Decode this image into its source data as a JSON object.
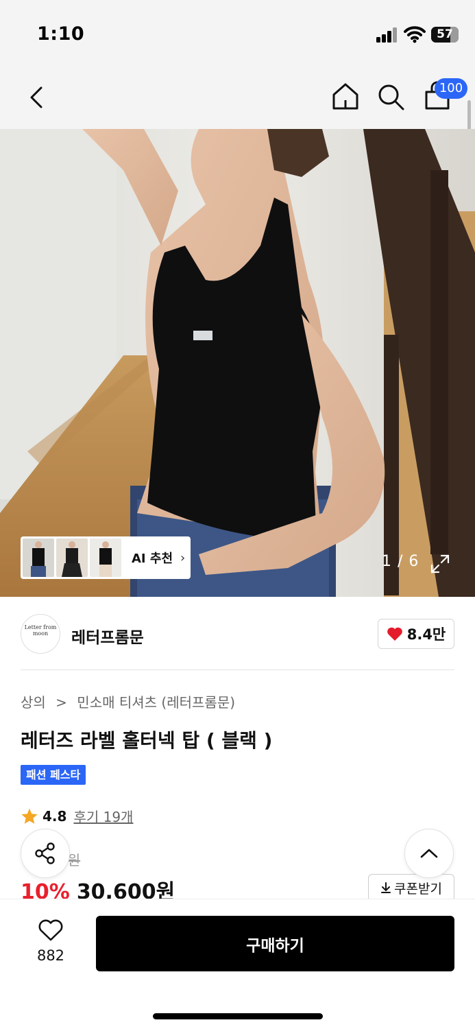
{
  "status_bar": {
    "time": "1:10",
    "battery": "57"
  },
  "nav": {
    "cart_count": "100"
  },
  "gallery": {
    "ai_label": "AI 추천",
    "pager": "1 / 6"
  },
  "brand": {
    "logo_text": "Letter from moon",
    "name": "레터프롬문",
    "likes": "8.4만"
  },
  "breadcrumb": {
    "level1": "상의",
    "separator": ">",
    "level2": "민소매 티셔츠 (레터프롬문)"
  },
  "product": {
    "title": "레터즈 라벨 홀터넥 탑 ( 블랙 )",
    "badge": "패션 페스타",
    "rating": "4.8",
    "review_link": "후기 19개",
    "original_price": "0원",
    "discount": "10%",
    "price": "30,600원",
    "coupon_label": "쿠폰받기"
  },
  "bottom": {
    "wish_count": "882",
    "buy_label": "구매하기"
  },
  "colors": {
    "accent_blue": "#2b66f6",
    "discount_red": "#e8202d",
    "star": "#f5a623",
    "heart": "#e41b2b"
  }
}
